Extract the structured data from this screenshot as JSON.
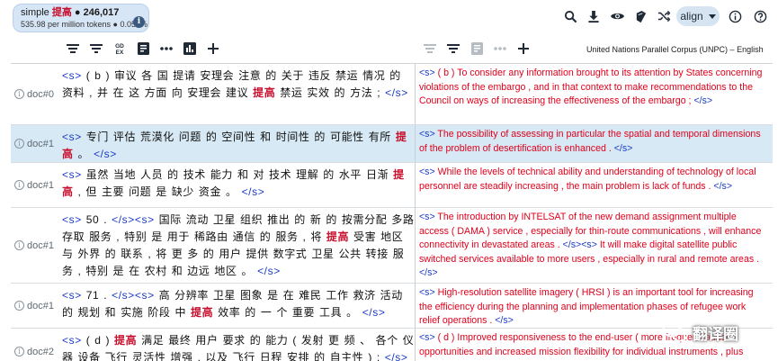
{
  "query": {
    "text_plain": "simple",
    "text_highlight": "提高",
    "count": "● 246,017",
    "stats": "535.98 per million tokens ● 0.054%",
    "info": "i"
  },
  "toolbar": {
    "align_label": "align",
    "icons": [
      "search-icon",
      "download-icon",
      "eye-icon",
      "dictionary-icon",
      "shuffle-icon",
      "info-icon",
      "help-icon"
    ]
  },
  "column_toolbar": {
    "corpus_label": "United Nations Parallel Corpus (UNPC) – English"
  },
  "rows": [
    {
      "doc": "doc#0",
      "src": [
        {
          "t": "<s>",
          "k": "tag"
        },
        {
          "t": " ( b ) 审议 各 国 提请 安理会 注意 的 关于 违反 禁运 情况 的 资料 , 并 在 这 方面 向 安理会 建议 "
        },
        {
          "t": "提高",
          "k": "hl"
        },
        {
          "t": " 禁运 实效 的 方法 ; "
        },
        {
          "t": "</s>",
          "k": "tag"
        }
      ],
      "tgt": [
        {
          "t": "<s>",
          "k": "tag"
        },
        {
          "t": "  ( b ) To consider any information brought to its attention by States concerning violations of the embargo , and in that context to make recommendations to the Council on ways of increasing the effectiveness of the embargo ;  "
        },
        {
          "t": "</s>",
          "k": "tag"
        }
      ]
    },
    {
      "doc": "doc#1",
      "src": [
        {
          "t": "<s>",
          "k": "tag"
        },
        {
          "t": " 专门 评估 荒漠化 问题 的 空间性 和 时间性 的 可能性 有所 "
        },
        {
          "t": "提高",
          "k": "hl"
        },
        {
          "t": " 。 "
        },
        {
          "t": "</s>",
          "k": "tag"
        }
      ],
      "tgt": [
        {
          "t": "<s>",
          "k": "tag"
        },
        {
          "t": "  The possibility of assessing in particular the spatial and temporal dimensions of the problem of desertification is enhanced .  "
        },
        {
          "t": "</s>",
          "k": "tag"
        }
      ]
    },
    {
      "doc": "doc#1",
      "src": [
        {
          "t": "<s>",
          "k": "tag"
        },
        {
          "t": " 虽然 当地 人员 的 技术 能力 和 对 技术 理解 的 水平 日渐 "
        },
        {
          "t": "提高",
          "k": "hl"
        },
        {
          "t": " , 但 主要 问题 是 缺少 资金 。 "
        },
        {
          "t": "</s>",
          "k": "tag"
        }
      ],
      "tgt": [
        {
          "t": "<s>",
          "k": "tag"
        },
        {
          "t": "  While the levels of technical ability and understanding of technology of local personnel are steadily increasing , the main problem is lack of funds .  "
        },
        {
          "t": "</s>",
          "k": "tag"
        }
      ]
    },
    {
      "doc": "doc#1",
      "src": [
        {
          "t": "<s>",
          "k": "tag"
        },
        {
          "t": " 50 . "
        },
        {
          "t": "</s><s>",
          "k": "tag"
        },
        {
          "t": " 国际 流动 卫星 组织 推出 的 新 的 按需分配 多路 存取 服务 , 特别 是 用于 稀路由 通信 的 服务 , 将 "
        },
        {
          "t": "提高",
          "k": "hl"
        },
        {
          "t": " 受害 地区 与 外界 的 联系 , 将 更 多 的 用户 提供 数字式 卫星 公共 转接 服务 , 特别 是 在 农村 和 边远 地区 。 "
        },
        {
          "t": "</s>",
          "k": "tag"
        }
      ],
      "tgt": [
        {
          "t": "<s>",
          "k": "tag"
        },
        {
          "t": "  The introduction by INTELSAT of the new demand assignment multiple access ( DAMA ) service , especially for thin-route communications , will enhance connectivity in devastated areas . "
        },
        {
          "t": "</s><s>",
          "k": "tag"
        },
        {
          "t": " It will make digital satellite public switched services available to more users , especially in rural and remote areas .  "
        },
        {
          "t": "</s>",
          "k": "tag"
        }
      ]
    },
    {
      "doc": "doc#1",
      "src": [
        {
          "t": "<s>",
          "k": "tag"
        },
        {
          "t": " 71 . "
        },
        {
          "t": "</s><s>",
          "k": "tag"
        },
        {
          "t": " 高 分辨率 卫星 图象 是 在 难民 工作 救济 活动 的 规划 和 实施 阶段 中 "
        },
        {
          "t": "提高",
          "k": "hl"
        },
        {
          "t": " 效率 的 一 个 重要 工具 。 "
        },
        {
          "t": "</s>",
          "k": "tag"
        }
      ],
      "tgt": [
        {
          "t": "<s>",
          "k": "tag"
        },
        {
          "t": "  High-resolution satellite imagery ( HRSI ) is an important tool for increasing the efficiency during the planning and implementation phases of refugee work relief operations .  "
        },
        {
          "t": "</s>",
          "k": "tag"
        }
      ]
    },
    {
      "doc": "doc#2",
      "src": [
        {
          "t": "<s>",
          "k": "tag"
        },
        {
          "t": " ( d ) "
        },
        {
          "t": "提高",
          "k": "hl"
        },
        {
          "t": " 满足 最终 用户 要求 的 能力 ( 发射 更 频 、 各个 仪器 设备 飞行 灵活性 增强 , 以及 飞行 日程 安排 的 自主性 ) ; "
        },
        {
          "t": "</s>",
          "k": "tag"
        }
      ],
      "tgt": [
        {
          "t": "<s>",
          "k": "tag"
        },
        {
          "t": "  ( d ) Improved responsiveness to the end-user ( more frequent launch opportunities and increased mission flexibility for individual instruments , plus"
        }
      ]
    }
  ],
  "watermark": {
    "text": "翻译圈"
  }
}
